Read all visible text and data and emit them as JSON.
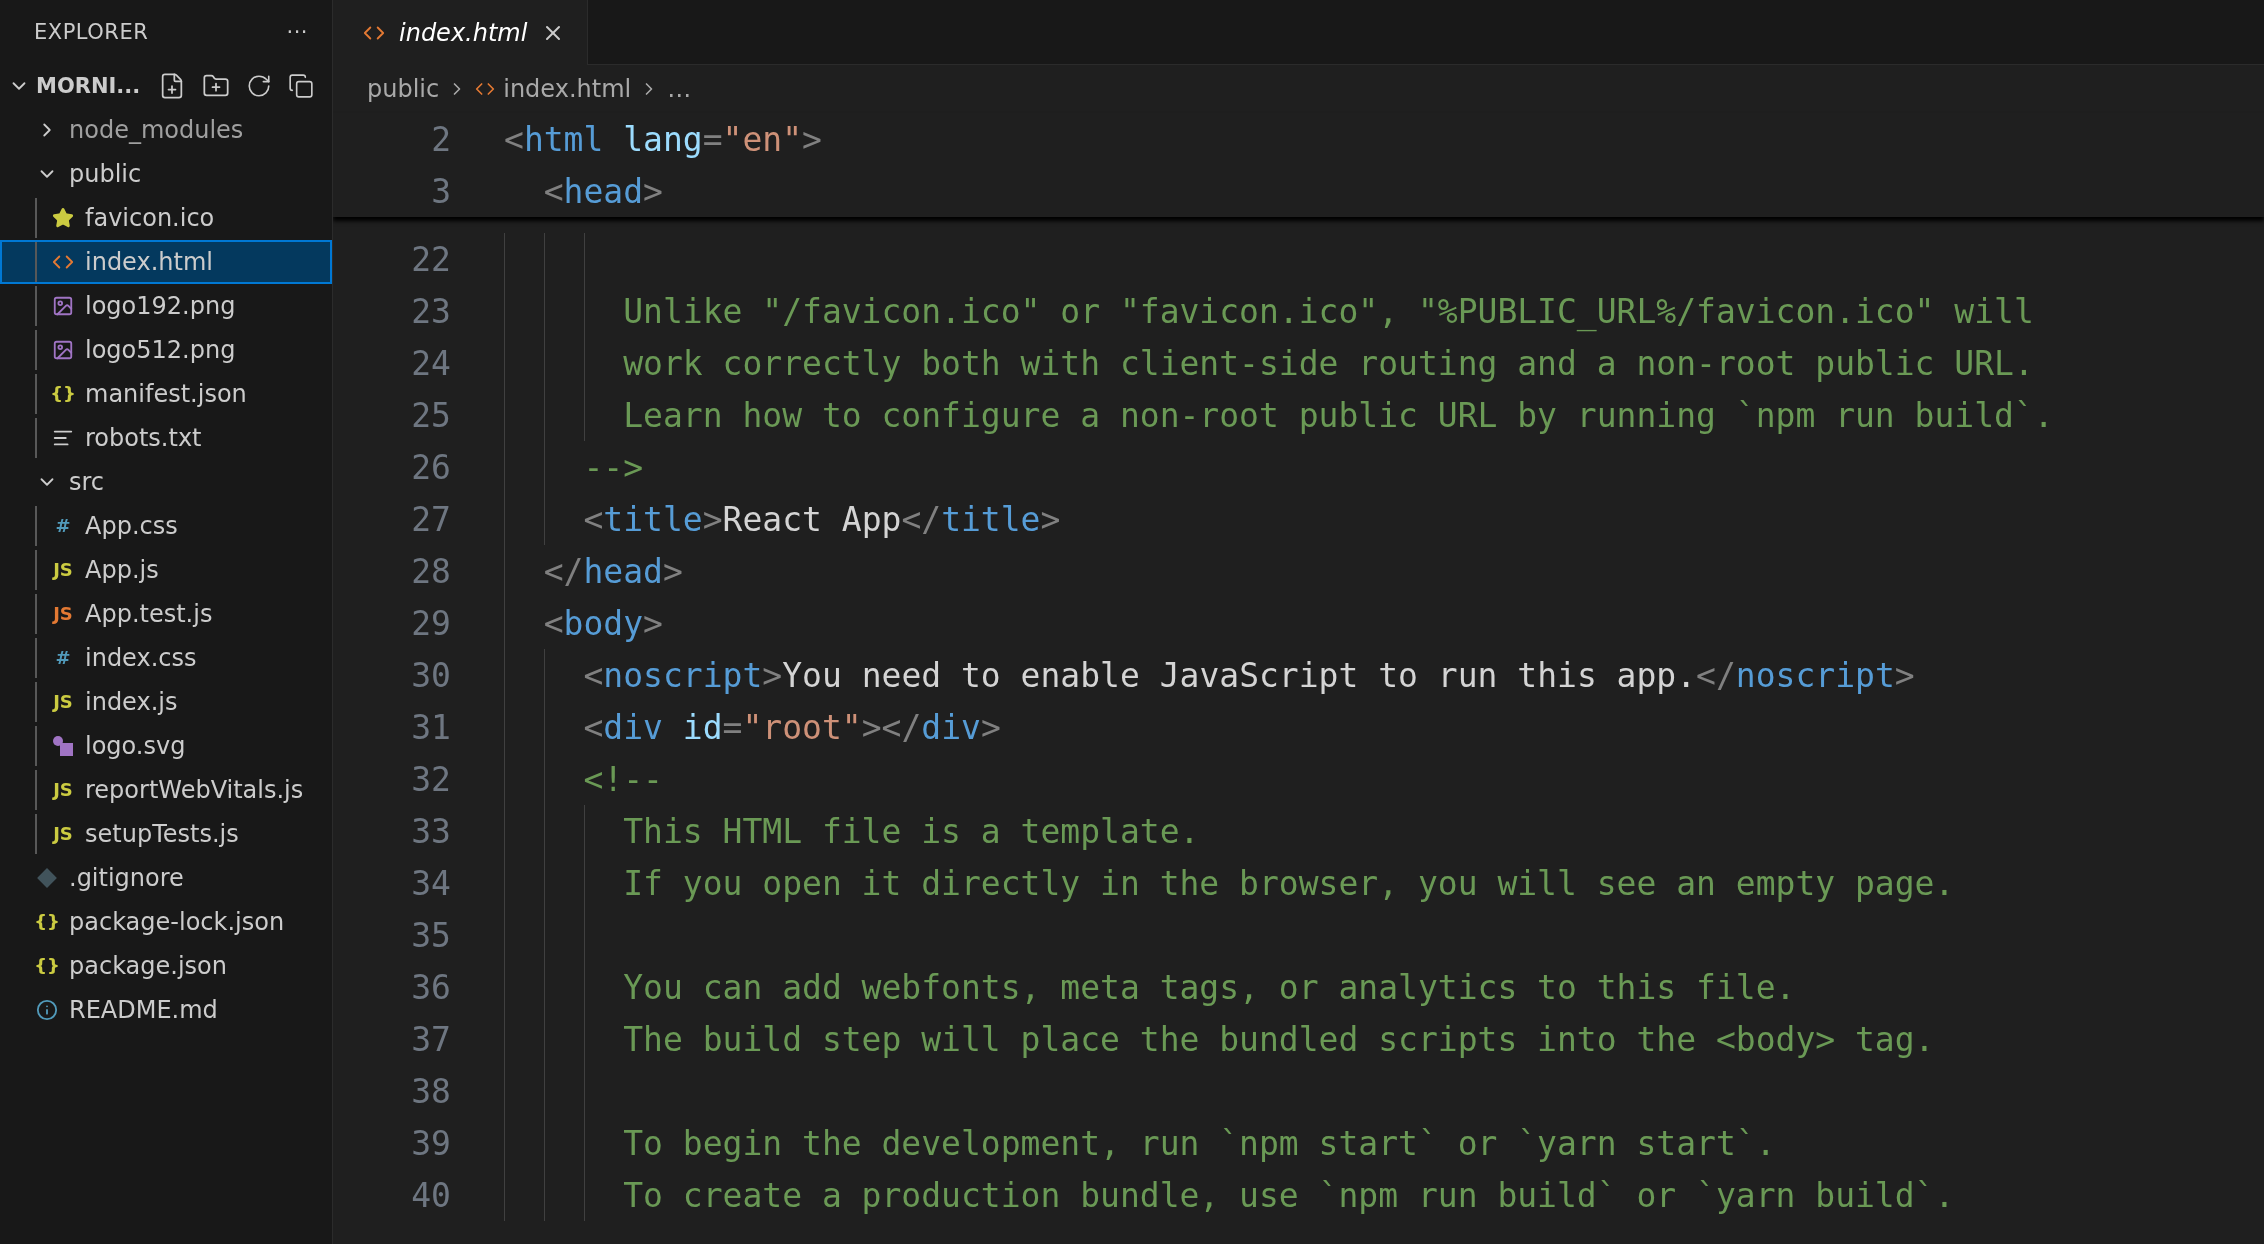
{
  "sidebar": {
    "title": "EXPLORER",
    "more": "···",
    "root": {
      "label": "MORNI...",
      "expanded": true
    },
    "items": [
      {
        "label": "node_modules",
        "kind": "folder",
        "expanded": false,
        "selected": false
      },
      {
        "label": "public",
        "kind": "folder",
        "expanded": true,
        "selected": false,
        "children": [
          {
            "label": "favicon.ico",
            "kind": "star",
            "selected": false
          },
          {
            "label": "index.html",
            "kind": "html",
            "selected": true
          },
          {
            "label": "logo192.png",
            "kind": "image",
            "selected": false
          },
          {
            "label": "logo512.png",
            "kind": "image",
            "selected": false
          },
          {
            "label": "manifest.json",
            "kind": "json",
            "badge": "{}",
            "selected": false
          },
          {
            "label": "robots.txt",
            "kind": "text",
            "selected": false
          }
        ]
      },
      {
        "label": "src",
        "kind": "folder",
        "expanded": true,
        "selected": false,
        "children": [
          {
            "label": "App.css",
            "kind": "css",
            "badge": "#",
            "selected": false
          },
          {
            "label": "App.js",
            "kind": "js",
            "badge": "JS",
            "selected": false
          },
          {
            "label": "App.test.js",
            "kind": "test",
            "badge": "JS",
            "selected": false
          },
          {
            "label": "index.css",
            "kind": "css",
            "badge": "#",
            "selected": false
          },
          {
            "label": "index.js",
            "kind": "js",
            "badge": "JS",
            "selected": false
          },
          {
            "label": "logo.svg",
            "kind": "svg",
            "selected": false
          },
          {
            "label": "reportWebVitals.js",
            "kind": "js",
            "badge": "JS",
            "selected": false
          },
          {
            "label": "setupTests.js",
            "kind": "js",
            "badge": "JS",
            "selected": false
          }
        ]
      },
      {
        "label": ".gitignore",
        "kind": "git",
        "selected": false
      },
      {
        "label": "package-lock.json",
        "kind": "json",
        "badge": "{}",
        "selected": false
      },
      {
        "label": "package.json",
        "kind": "json",
        "badge": "{}",
        "selected": false
      },
      {
        "label": "README.md",
        "kind": "info",
        "selected": false
      }
    ]
  },
  "tabs": [
    {
      "label": "index.html",
      "selected": true,
      "preview": true
    }
  ],
  "breadcrumb": [
    "public",
    "index.html",
    "…"
  ],
  "sticky_lines": [
    {
      "number": "2",
      "tokens": [
        {
          "kind": "punct",
          "text": "<"
        },
        {
          "kind": "tag",
          "text": "html"
        },
        {
          "kind": "attr",
          "text": " lang"
        },
        {
          "kind": "punct",
          "text": "="
        },
        {
          "kind": "string",
          "text": "\"en\""
        },
        {
          "kind": "punct",
          "text": ">"
        }
      ]
    },
    {
      "number": "3",
      "tokens": [
        {
          "kind": "punct",
          "text": "  <"
        },
        {
          "kind": "tag",
          "text": "head"
        },
        {
          "kind": "punct",
          "text": ">"
        }
      ]
    }
  ],
  "lines": [
    {
      "number": "22"
    },
    {
      "number": "23",
      "tokens": [
        {
          "kind": "comment",
          "text": "      Unlike \"/favicon.ico\" or \"favicon.ico\", \"%PUBLIC_URL%/favicon.ico\" will"
        }
      ]
    },
    {
      "number": "24",
      "tokens": [
        {
          "kind": "comment",
          "text": "      work correctly both with client-side routing and a non-root public URL."
        }
      ]
    },
    {
      "number": "25",
      "tokens": [
        {
          "kind": "comment",
          "text": "      Learn how to configure a non-root public URL by running `npm run build`."
        }
      ]
    },
    {
      "number": "26",
      "tokens": [
        {
          "kind": "comment",
          "text": "    -->"
        }
      ]
    },
    {
      "number": "27",
      "tokens": [
        {
          "kind": "punct",
          "text": "    <"
        },
        {
          "kind": "tag",
          "text": "title"
        },
        {
          "kind": "punct",
          "text": ">"
        },
        {
          "kind": "text",
          "text": "React App"
        },
        {
          "kind": "punct",
          "text": "</"
        },
        {
          "kind": "tag",
          "text": "title"
        },
        {
          "kind": "punct",
          "text": ">"
        }
      ]
    },
    {
      "number": "28",
      "tokens": [
        {
          "kind": "punct",
          "text": "  </"
        },
        {
          "kind": "tag",
          "text": "head"
        },
        {
          "kind": "punct",
          "text": ">"
        }
      ]
    },
    {
      "number": "29",
      "tokens": [
        {
          "kind": "punct",
          "text": "  <"
        },
        {
          "kind": "tag",
          "text": "body"
        },
        {
          "kind": "punct",
          "text": ">"
        }
      ]
    },
    {
      "number": "30",
      "tokens": [
        {
          "kind": "punct",
          "text": "    <"
        },
        {
          "kind": "tag",
          "text": "noscript"
        },
        {
          "kind": "punct",
          "text": ">"
        },
        {
          "kind": "text",
          "text": "You need to enable JavaScript to run this app."
        },
        {
          "kind": "punct",
          "text": "</"
        },
        {
          "kind": "tag",
          "text": "noscript"
        },
        {
          "kind": "punct",
          "text": ">"
        }
      ]
    },
    {
      "number": "31",
      "tokens": [
        {
          "kind": "punct",
          "text": "    <"
        },
        {
          "kind": "tag",
          "text": "div"
        },
        {
          "kind": "attr",
          "text": " id"
        },
        {
          "kind": "punct",
          "text": "="
        },
        {
          "kind": "string",
          "text": "\"root\""
        },
        {
          "kind": "punct",
          "text": "></"
        },
        {
          "kind": "tag",
          "text": "div"
        },
        {
          "kind": "punct",
          "text": ">"
        }
      ]
    },
    {
      "number": "32",
      "tokens": [
        {
          "kind": "comment",
          "text": "    <!--"
        }
      ]
    },
    {
      "number": "33",
      "tokens": [
        {
          "kind": "comment",
          "text": "      This HTML file is a template."
        }
      ]
    },
    {
      "number": "34",
      "tokens": [
        {
          "kind": "comment",
          "text": "      If you open it directly in the browser, you will see an empty page."
        }
      ]
    },
    {
      "number": "35"
    },
    {
      "number": "36",
      "tokens": [
        {
          "kind": "comment",
          "text": "      You can add webfonts, meta tags, or analytics to this file."
        }
      ]
    },
    {
      "number": "37",
      "tokens": [
        {
          "kind": "comment",
          "text": "      The build step will place the bundled scripts into the <body> tag."
        }
      ]
    },
    {
      "number": "38"
    },
    {
      "number": "39",
      "tokens": [
        {
          "kind": "comment",
          "text": "      To begin the development, run `npm start` or `yarn start`."
        }
      ]
    },
    {
      "number": "40",
      "tokens": [
        {
          "kind": "comment",
          "text": "      To create a production bundle, use `npm run build` or `yarn build`."
        }
      ]
    }
  ]
}
